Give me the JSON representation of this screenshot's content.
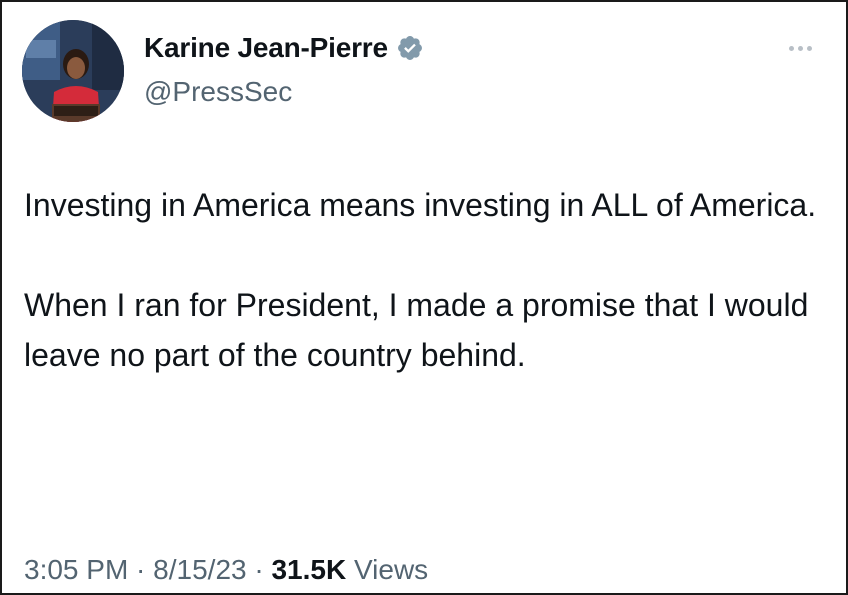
{
  "author": {
    "name": "Karine Jean-Pierre",
    "handle": "@PressSec",
    "verified_badge_icon": "verified-badge-icon",
    "avatar_icon": "profile-photo-avatar"
  },
  "menu": {
    "more_icon": "more-options-icon"
  },
  "tweet": {
    "paragraph_1": "Investing in America means investing in ALL of America.",
    "paragraph_2": "When I ran for President, I made a promise that I would leave no part of the country behind."
  },
  "meta": {
    "time": "3:05 PM",
    "sep1": " · ",
    "date": "8/15/23",
    "sep2": " · ",
    "views_count": "31.5K",
    "views_label": " Views"
  },
  "colors": {
    "text_primary": "#0f1419",
    "text_secondary": "#536471",
    "verified_badge": "#829aab",
    "frame_border": "#1a1a1a"
  }
}
